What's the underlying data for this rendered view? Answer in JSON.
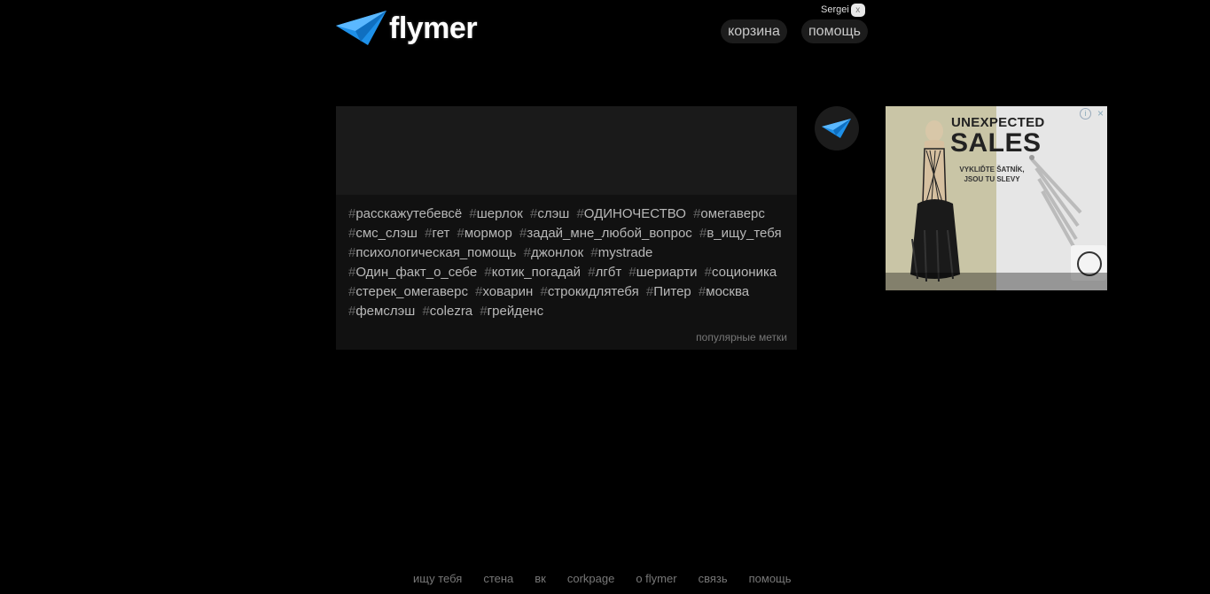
{
  "header": {
    "logo_text": "flymer",
    "user_name": "Sergei",
    "user_close": "x",
    "nav": {
      "cart": "корзина",
      "help": "помощь"
    }
  },
  "tags": [
    "расскажутебевсё",
    "шерлок",
    "слэш",
    "ОДИНОЧЕСТВО",
    "омегаверс",
    "смс_слэш",
    "гет",
    "мормор",
    "задай_мне_любой_вопрос",
    "в_ищу_тебя",
    "психологическая_помощь",
    "джонлок",
    "mystrade",
    "Один_факт_о_себе",
    "котик_погадай",
    "лгбт",
    "шериарти",
    "соционика",
    "стерек_омегаверс",
    "ховарин",
    "строкидлятебя",
    "Питер",
    "москва",
    "фемслэш",
    "colezra",
    "грейденс"
  ],
  "tag_hash": "#",
  "panel_footer": "популярные метки",
  "ad": {
    "headline": "UNEXPECTED",
    "headline_big": "SALES",
    "subline": "VYKLIĎTE ŠATNÍK, JSOU TU SLEVY",
    "info": "i",
    "close": "×"
  },
  "footer": [
    "ищу тебя",
    "стена",
    "вк",
    "corkpage",
    "о flymer",
    "связь",
    "помощь"
  ],
  "colors": {
    "background": "#000000",
    "brand_blue": "#1e90e8",
    "panel": "#111111",
    "tag_text": "#b8b8b8"
  },
  "icons": {
    "logo": "paper-plane-icon",
    "plane_button": "paper-plane-icon"
  }
}
